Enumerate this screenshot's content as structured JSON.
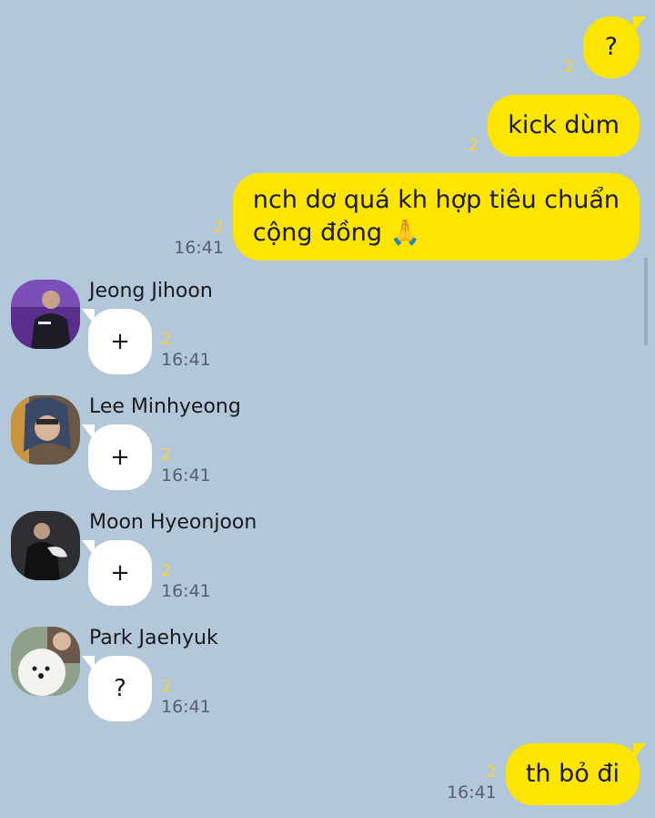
{
  "colors": {
    "background": "#b2c7da",
    "my_bubble": "#fee500",
    "their_bubble": "#ffffff",
    "unread_count": "#f5d23c"
  },
  "outgoing": [
    {
      "text": "?",
      "unread": "2",
      "time": ""
    },
    {
      "text": "kick dùm",
      "unread": "2",
      "time": ""
    },
    {
      "text": "nch dơ quá kh hợp tiêu chuẩn\ncộng đồng 🙏",
      "unread": "2",
      "time": "16:41"
    },
    {
      "text": "th bỏ đi",
      "unread": "2",
      "time": "16:41"
    }
  ],
  "incoming": [
    {
      "sender": "Jeong Jihoon",
      "text": "+",
      "unread": "2",
      "time": "16:41",
      "avatar": "person-photo"
    },
    {
      "sender": "Lee Minhyeong",
      "text": "+",
      "unread": "2",
      "time": "16:41",
      "avatar": "person-photo"
    },
    {
      "sender": "Moon Hyeonjoon",
      "text": "+",
      "unread": "2",
      "time": "16:41",
      "avatar": "person-photo"
    },
    {
      "sender": "Park Jaehyuk",
      "text": "?",
      "unread": "2",
      "time": "16:41",
      "avatar": "dog-photo"
    }
  ]
}
